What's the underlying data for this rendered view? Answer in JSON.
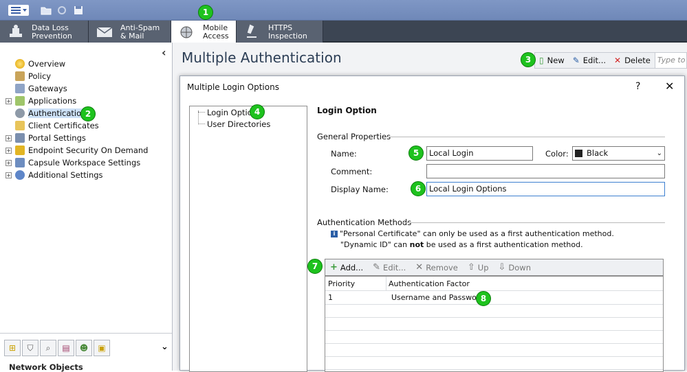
{
  "topbar": {
    "menu_icon": "menu-icon",
    "quick_icons": [
      "folder-icon",
      "refresh-icon",
      "save-icon"
    ]
  },
  "tabs": [
    {
      "line1": "Data Loss",
      "line2": "Prevention",
      "icon": "dlp-icon"
    },
    {
      "line1": "Anti-Spam",
      "line2": "& Mail",
      "icon": "mail-icon"
    },
    {
      "line1": "Mobile",
      "line2": "Access",
      "icon": "mobile-access-icon"
    },
    {
      "line1": "HTTPS",
      "line2": "Inspection",
      "icon": "microscope-icon"
    }
  ],
  "sidebar": {
    "collapse_glyph": "‹",
    "items": [
      {
        "label": "Overview",
        "expand": ""
      },
      {
        "label": "Policy",
        "expand": ""
      },
      {
        "label": "Gateways",
        "expand": ""
      },
      {
        "label": "Applications",
        "expand": "+"
      },
      {
        "label": "Authentication",
        "expand": ""
      },
      {
        "label": "Client Certificates",
        "expand": ""
      },
      {
        "label": "Portal Settings",
        "expand": "+"
      },
      {
        "label": "Endpoint Security On Demand",
        "expand": "+"
      },
      {
        "label": "Capsule Workspace Settings",
        "expand": "+"
      },
      {
        "label": "Additional Settings",
        "expand": "+"
      }
    ],
    "footer_label": "Network Objects",
    "footer_chevron": "⌄"
  },
  "badges": [
    "1",
    "2",
    "3",
    "4",
    "5",
    "6",
    "7",
    "8"
  ],
  "main": {
    "title": "Multiple Authentication",
    "toolbar": {
      "new": "New",
      "edit": "Edit...",
      "delete": "Delete",
      "search_placeholder": "Type to"
    }
  },
  "dialog": {
    "title": "Multiple Login Options",
    "help": "?",
    "close": "✕",
    "tree": [
      "Login Option",
      "User Directories"
    ],
    "heading": "Login Option",
    "general_properties": "General Properties",
    "name_label": "Name:",
    "name_value": "Local Login",
    "color_label": "Color:",
    "color_value": "Black",
    "comment_label": "Comment:",
    "comment_value": "",
    "display_name_label": "Display Name:",
    "display_name_value": "Local Login Options",
    "auth_methods": "Authentication Methods",
    "info_line1": "\"Personal Certificate\" can only be used as a first authentication method.",
    "info_line2_pre": "\"Dynamic ID\" can ",
    "info_line2_bold": "not",
    "info_line2_post": " be used as a first authentication method.",
    "grid_toolbar": {
      "add": "Add...",
      "edit": "Edit...",
      "remove": "Remove",
      "up": "Up",
      "down": "Down"
    },
    "grid_columns": [
      "Priority",
      "Authentication Factor"
    ],
    "grid_rows": [
      {
        "priority": "1",
        "factor": "Username and Password"
      }
    ]
  },
  "colors": {
    "badge": "#1ec21e",
    "tab_bar": "#3c4553",
    "title": "#2c3e55",
    "delete_red": "#d32222"
  }
}
